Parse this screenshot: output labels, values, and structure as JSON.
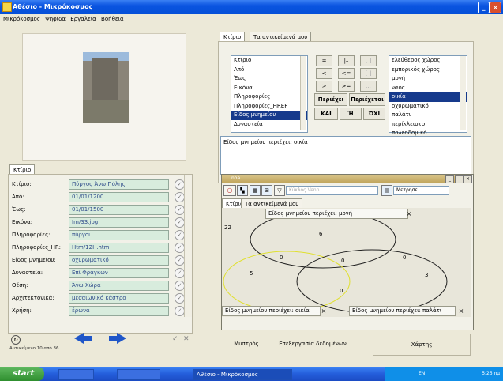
{
  "window": {
    "title": "Αθέσιο - Μικρόκοσμος"
  },
  "menu": [
    "Μικρόκοσμος",
    "Ψηφίδα",
    "Εργαλεία",
    "Βοήθεια"
  ],
  "left_tabs": [
    "Κτίριο"
  ],
  "form": {
    "rows": [
      {
        "label": "Κτίριο:",
        "value": "Πύργος Άνω Πόλης"
      },
      {
        "label": "Από:",
        "value": "01/01/1200"
      },
      {
        "label": "Έως:",
        "value": "01/01/1500"
      },
      {
        "label": "Εικόνα:",
        "value": "Im/33.jpg"
      },
      {
        "label": "Πληροφορίες:",
        "value": "πύργοι"
      },
      {
        "label": "Πληροφορίες_HR:",
        "value": "Htm/12H.htm"
      },
      {
        "label": "Είδος μνημείου:",
        "value": "οχυρωματικό"
      },
      {
        "label": "Δυναστεία:",
        "value": "Επί Φράγκων"
      },
      {
        "label": "Θέση:",
        "value": "Άνω Χώρα"
      },
      {
        "label": "Αρχιτεκτονικά:",
        "value": "μεσαιωνικό κάστρο"
      },
      {
        "label": "Χρήση:",
        "value": "έρωνα"
      }
    ],
    "status": "Αντικείμενο 10 από 36"
  },
  "query_tabs": [
    "Κτίριο",
    "Τα αντικείμενά μου"
  ],
  "fields_list": [
    "Κτίριο",
    "Από",
    "Έως",
    "Εικόνα",
    "Πληροφορίες",
    "Πληροφορίες_HREF",
    "Είδος μνημείου",
    "Δυναστεία"
  ],
  "fields_selected_index": 6,
  "operators": {
    "row1": [
      "=",
      "|–",
      "[ ]"
    ],
    "row2": [
      "<",
      "<=",
      "[ ]"
    ],
    "row3": [
      ">",
      ">=",
      "..."
    ],
    "contains": "Περιέχει",
    "not_contains": "Περιέχεται",
    "and": "ΚΑΙ",
    "or": "Ή",
    "not": "ΌΧΙ"
  },
  "values_list": [
    "ελεύθερος χώρος",
    "εμπορικός χώρος",
    "μονή",
    "ναός",
    "οικία",
    "οχυρωματικό",
    "παλάτι",
    "περίκλειστο",
    "πολεοδομικό"
  ],
  "values_selected_index": 4,
  "query_text": "Είδος μνημείου περιέχει: οικία",
  "venn_window": {
    "title": "noa",
    "combo_placeholder": "Κύκλος Venn",
    "metric_label": "Μετρησε",
    "tabs": [
      "Κτίριο",
      "Τα αντικείμενά μου"
    ],
    "set_labels": {
      "top": "Είδος μνημείου περιέχει: μονή",
      "left": "Είδος μνημείου περιέχει: οικία",
      "right": "Είδος μνημείου περιέχει: παλάτι"
    },
    "counts": {
      "outside": "22",
      "top_only": "6",
      "left_top": "0",
      "center": "0",
      "right_top": "0",
      "left_only": "5",
      "bottom_overlap": "0",
      "right_only": "3"
    }
  },
  "bottom_buttons": [
    "Μυστρός",
    "Επεξεργασία δεδομένων",
    "Χάρτης"
  ],
  "taskbar": {
    "start": "start",
    "items": [
      "",
      "Αθέσιο - Μικρόκοσμος"
    ],
    "lang": "EN",
    "clock": "5:25 πμ"
  }
}
